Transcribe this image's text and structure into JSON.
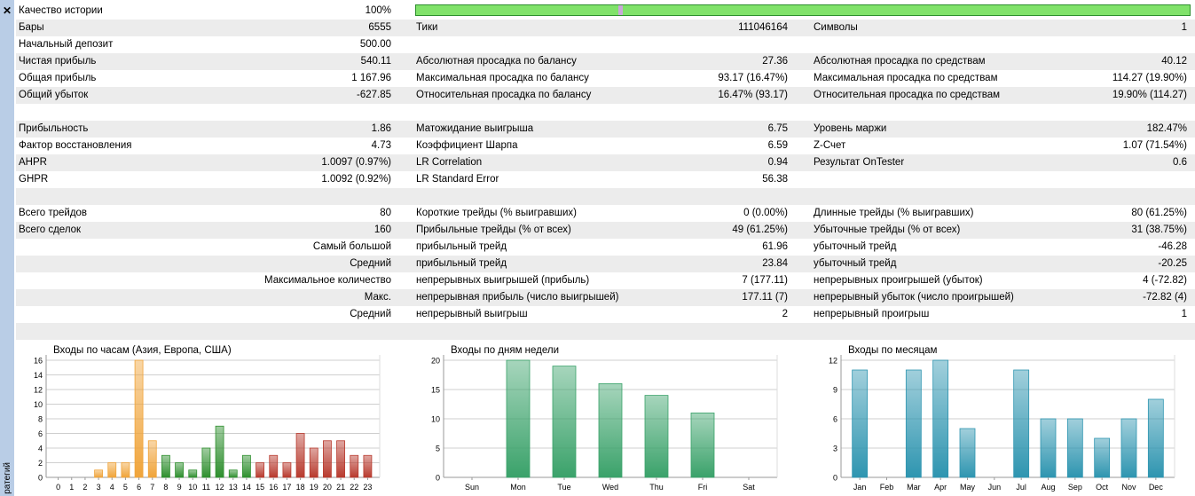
{
  "sidebar": {
    "close_glyph": "✕",
    "vertical_label": "ратегий"
  },
  "report": {
    "quality_label": "Качество истории",
    "quality_value": "100%",
    "quality_fraction": 1.0,
    "rows": [
      {
        "alt": true,
        "c1": [
          "Бары",
          "6555"
        ],
        "c2": [
          "Тики",
          "111046164"
        ],
        "c3": [
          "Символы",
          "1"
        ]
      },
      {
        "alt": false,
        "c1": [
          "Начальный депозит",
          "500.00"
        ],
        "c2": [
          "",
          ""
        ],
        "c3": [
          "",
          ""
        ]
      },
      {
        "alt": true,
        "c1": [
          "Чистая прибыль",
          "540.11"
        ],
        "c2": [
          "Абсолютная просадка по балансу",
          "27.36"
        ],
        "c3": [
          "Абсолютная просадка по средствам",
          "40.12"
        ]
      },
      {
        "alt": false,
        "c1": [
          "Общая прибыль",
          "1 167.96"
        ],
        "c2": [
          "Максимальная просадка по балансу",
          "93.17 (16.47%)"
        ],
        "c3": [
          "Максимальная просадка по средствам",
          "114.27 (19.90%)"
        ]
      },
      {
        "alt": true,
        "c1": [
          "Общий убыток",
          "-627.85"
        ],
        "c2": [
          "Относительная просадка по балансу",
          "16.47% (93.17)"
        ],
        "c3": [
          "Относительная просадка по средствам",
          "19.90% (114.27)"
        ]
      },
      {
        "alt": false,
        "c1": [
          "",
          ""
        ],
        "c2": [
          "",
          ""
        ],
        "c3": [
          "",
          ""
        ]
      },
      {
        "alt": true,
        "c1": [
          "Прибыльность",
          "1.86"
        ],
        "c2": [
          "Матожидание выигрыша",
          "6.75"
        ],
        "c3": [
          "Уровень маржи",
          "182.47%"
        ]
      },
      {
        "alt": false,
        "c1": [
          "Фактор восстановления",
          "4.73"
        ],
        "c2": [
          "Коэффициент Шарпа",
          "6.59"
        ],
        "c3": [
          "Z-Счет",
          "1.07 (71.54%)"
        ]
      },
      {
        "alt": true,
        "c1": [
          "AHPR",
          "1.0097 (0.97%)"
        ],
        "c2": [
          "LR Correlation",
          "0.94"
        ],
        "c3": [
          "Результат OnTester",
          "0.6"
        ]
      },
      {
        "alt": false,
        "c1": [
          "GHPR",
          "1.0092 (0.92%)"
        ],
        "c2": [
          "LR Standard Error",
          "56.38"
        ],
        "c3": [
          "",
          ""
        ]
      },
      {
        "alt": true,
        "c1": [
          "",
          ""
        ],
        "c2": [
          "",
          ""
        ],
        "c3": [
          "",
          ""
        ]
      },
      {
        "alt": false,
        "c1": [
          "Всего трейдов",
          "80"
        ],
        "c2": [
          "Короткие трейды (% выигравших)",
          "0 (0.00%)"
        ],
        "c3": [
          "Длинные трейды (% выигравших)",
          "80 (61.25%)"
        ]
      },
      {
        "alt": true,
        "c1": [
          "Всего сделок",
          "160"
        ],
        "c2": [
          "Прибыльные трейды (% от всех)",
          "49 (61.25%)"
        ],
        "c3": [
          "Убыточные трейды (% от всех)",
          "31 (38.75%)"
        ]
      },
      {
        "alt": false,
        "c1": [
          "",
          "Самый большой"
        ],
        "c2": [
          "прибыльный трейд",
          "61.96"
        ],
        "c3": [
          "убыточный трейд",
          "-46.28"
        ]
      },
      {
        "alt": true,
        "c1": [
          "",
          "Средний"
        ],
        "c2": [
          "прибыльный трейд",
          "23.84"
        ],
        "c3": [
          "убыточный трейд",
          "-20.25"
        ]
      },
      {
        "alt": false,
        "c1": [
          "",
          "Максимальное количество"
        ],
        "c2": [
          "непрерывных выигрышей (прибыль)",
          "7 (177.11)"
        ],
        "c3": [
          "непрерывных проигрышей (убыток)",
          "4 (-72.82)"
        ]
      },
      {
        "alt": true,
        "c1": [
          "",
          "Макс."
        ],
        "c2": [
          "непрерывная прибыль (число выигрышей)",
          "177.11 (7)"
        ],
        "c3": [
          "непрерывный убыток (число проигрышей)",
          "-72.82 (4)"
        ]
      },
      {
        "alt": false,
        "c1": [
          "",
          "Средний"
        ],
        "c2": [
          "непрерывный выигрыш",
          "2"
        ],
        "c3": [
          "непрерывный проигрыш",
          "1"
        ]
      },
      {
        "alt": true,
        "c1": [
          "",
          ""
        ],
        "c2": [
          "",
          ""
        ],
        "c3": [
          "",
          ""
        ]
      }
    ]
  },
  "chart_data": [
    {
      "type": "bar",
      "title": "Входы по часам (Азия, Европа, США)",
      "categories": [
        "0",
        "1",
        "2",
        "3",
        "4",
        "5",
        "6",
        "7",
        "8",
        "9",
        "10",
        "11",
        "12",
        "13",
        "14",
        "15",
        "16",
        "17",
        "18",
        "19",
        "20",
        "21",
        "22",
        "23"
      ],
      "values": [
        0,
        0,
        0,
        1,
        2,
        2,
        16,
        5,
        3,
        2,
        1,
        4,
        7,
        1,
        3,
        2,
        3,
        2,
        6,
        4,
        5,
        5,
        3,
        3
      ],
      "ylim": [
        0,
        16
      ],
      "yticks": [
        0,
        2,
        4,
        6,
        8,
        10,
        12,
        14,
        16
      ],
      "grid": true,
      "colors": {
        "asia": "#f0a43a",
        "europe": "#2e8f2e",
        "usa": "#b83a2e"
      }
    },
    {
      "type": "bar",
      "title": "Входы по дням недели",
      "categories": [
        "Sun",
        "Mon",
        "Tue",
        "Wed",
        "Thu",
        "Fri",
        "Sat"
      ],
      "values": [
        0,
        20,
        19,
        16,
        14,
        11,
        0
      ],
      "ylim": [
        0,
        20
      ],
      "yticks": [
        0,
        5,
        10,
        15,
        20
      ],
      "grid": true,
      "color": "#3aa26a"
    },
    {
      "type": "bar",
      "title": "Входы по месяцам",
      "categories": [
        "Jan",
        "Feb",
        "Mar",
        "Apr",
        "May",
        "Jun",
        "Jul",
        "Aug",
        "Sep",
        "Oct",
        "Nov",
        "Dec"
      ],
      "values": [
        11,
        0,
        11,
        12,
        5,
        0,
        11,
        6,
        6,
        4,
        6,
        8
      ],
      "ylim": [
        0,
        12
      ],
      "yticks": [
        0,
        3,
        6,
        9,
        12
      ],
      "grid": true,
      "color": "#2e95b0"
    }
  ]
}
